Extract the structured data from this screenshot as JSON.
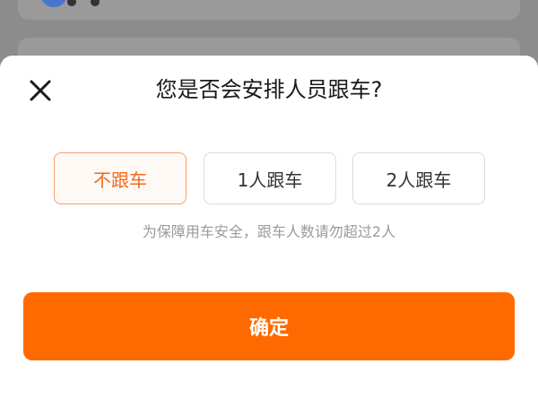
{
  "dialog": {
    "title": "您是否会安排人员跟车?",
    "options": [
      {
        "label": "不跟车",
        "selected": true
      },
      {
        "label": "1人跟车",
        "selected": false
      },
      {
        "label": "2人跟车",
        "selected": false
      }
    ],
    "hint": "为保障用车安全，跟车人数请勿超过2人",
    "confirm_label": "确定"
  },
  "colors": {
    "accent": "#ff6a00",
    "selected_text": "#f26a1b",
    "selected_border": "#f5a06a",
    "hint_text": "#9a9a9a",
    "overlay": "#8c8c8c"
  },
  "icons": {
    "close": "close-icon",
    "vehicle": "truck-icon"
  }
}
